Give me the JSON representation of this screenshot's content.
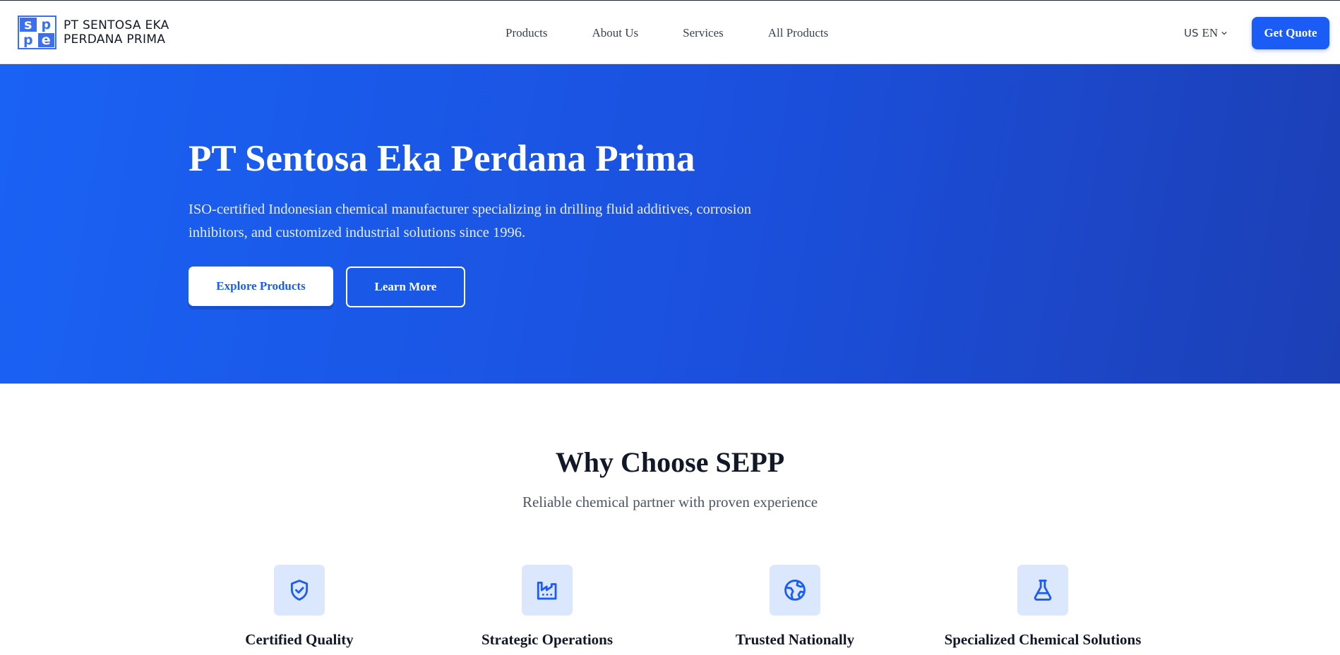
{
  "header": {
    "logo": {
      "letters": [
        "s",
        "p",
        "p",
        "e"
      ],
      "line1": "PT SENTOSA EKA",
      "line2": "PERDANA PRIMA"
    },
    "nav": [
      {
        "label": "Products"
      },
      {
        "label": "About Us"
      },
      {
        "label": "Services"
      },
      {
        "label": "All Products"
      }
    ],
    "language": {
      "flag": "US",
      "label": "EN"
    },
    "quote_button": "Get Quote"
  },
  "hero": {
    "title": "PT Sentosa Eka Perdana Prima",
    "description": "ISO-certified Indonesian chemical manufacturer specializing in drilling fluid additives, corrosion inhibitors, and customized industrial solutions since 1996.",
    "primary_button": "Explore Products",
    "secondary_button": "Learn More"
  },
  "why": {
    "title": "Why Choose SEPP",
    "subtitle": "Reliable chemical partner with proven experience",
    "features": [
      {
        "icon": "shield-check-icon",
        "title": "Certified Quality"
      },
      {
        "icon": "factory-icon",
        "title": "Strategic Operations"
      },
      {
        "icon": "globe-icon",
        "title": "Trusted Nationally"
      },
      {
        "icon": "flask-icon",
        "title": "Specialized Chemical Solutions"
      }
    ]
  },
  "colors": {
    "brand": "#1a5cf5",
    "hero_start": "#1a62f4",
    "hero_end": "#1c3fb5",
    "icon_bg": "#dbe7fd"
  }
}
